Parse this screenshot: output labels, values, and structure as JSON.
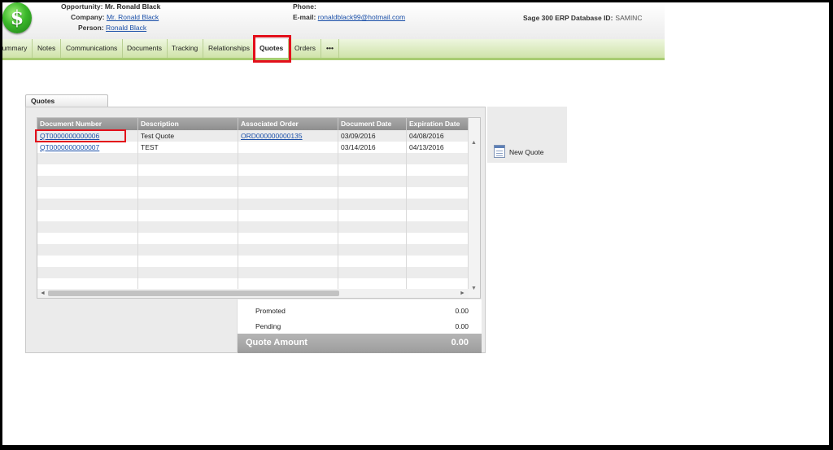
{
  "header": {
    "opportunity_label": "Opportunity:",
    "opportunity_value": "Mr. Ronald Black",
    "company_label": "Company:",
    "company_value": "Mr. Ronald Black",
    "person_label": "Person:",
    "person_value": "Ronald Black",
    "phone_label": "Phone:",
    "phone_value": "",
    "email_label": "E-mail:",
    "email_value": "ronaldblack99@hotmail.com",
    "erp_label": "Sage 300 ERP Database ID:",
    "erp_value": "SAMINC",
    "logo_glyph": "$"
  },
  "tabs": [
    {
      "label": "Summary"
    },
    {
      "label": "Notes"
    },
    {
      "label": "Communications"
    },
    {
      "label": "Documents"
    },
    {
      "label": "Tracking"
    },
    {
      "label": "Relationships"
    },
    {
      "label": "Quotes",
      "active": true
    },
    {
      "label": "Orders"
    },
    {
      "label": "•••"
    }
  ],
  "quotes": {
    "tab_label": "Quotes",
    "columns": [
      "Document Number",
      "Description",
      "Associated Order",
      "Document Date",
      "Expiration Date"
    ],
    "rows": [
      [
        "QT0000000000006",
        "Test Quote",
        "ORD000000000135",
        "03/09/2016",
        "04/08/2016"
      ],
      [
        "QT0000000000007",
        "TEST",
        "",
        "03/14/2016",
        "04/13/2016"
      ]
    ],
    "summary": {
      "promoted_label": "Promoted",
      "promoted_value": "0.00",
      "pending_label": "Pending",
      "pending_value": "0.00",
      "total_label": "Quote Amount",
      "total_value": "0.00"
    },
    "new_quote_label": "New Quote"
  },
  "colors": {
    "highlight": "#e3101b",
    "link": "#1a4fa8",
    "tabbar": "#cfe3a9"
  }
}
